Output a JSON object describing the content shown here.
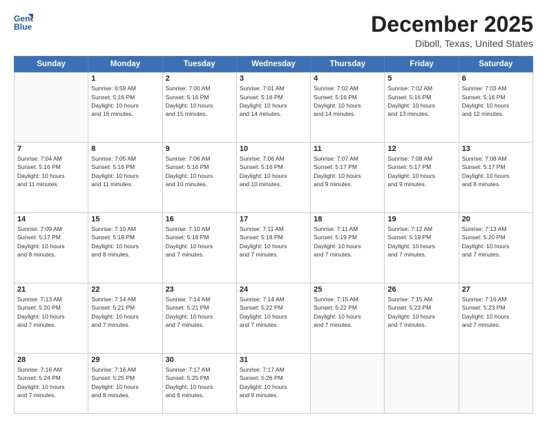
{
  "logo": {
    "line1": "General",
    "line2": "Blue"
  },
  "title": "December 2025",
  "subtitle": "Diboll, Texas, United States",
  "days_of_week": [
    "Sunday",
    "Monday",
    "Tuesday",
    "Wednesday",
    "Thursday",
    "Friday",
    "Saturday"
  ],
  "weeks": [
    [
      {
        "num": "",
        "info": ""
      },
      {
        "num": "1",
        "info": "Sunrise: 6:59 AM\nSunset: 5:16 PM\nDaylight: 10 hours\nand 16 minutes."
      },
      {
        "num": "2",
        "info": "Sunrise: 7:00 AM\nSunset: 5:16 PM\nDaylight: 10 hours\nand 15 minutes."
      },
      {
        "num": "3",
        "info": "Sunrise: 7:01 AM\nSunset: 5:16 PM\nDaylight: 10 hours\nand 14 minutes."
      },
      {
        "num": "4",
        "info": "Sunrise: 7:02 AM\nSunset: 5:16 PM\nDaylight: 10 hours\nand 14 minutes."
      },
      {
        "num": "5",
        "info": "Sunrise: 7:02 AM\nSunset: 5:16 PM\nDaylight: 10 hours\nand 13 minutes."
      },
      {
        "num": "6",
        "info": "Sunrise: 7:03 AM\nSunset: 5:16 PM\nDaylight: 10 hours\nand 12 minutes."
      }
    ],
    [
      {
        "num": "7",
        "info": "Sunrise: 7:04 AM\nSunset: 5:16 PM\nDaylight: 10 hours\nand 11 minutes."
      },
      {
        "num": "8",
        "info": "Sunrise: 7:05 AM\nSunset: 5:16 PM\nDaylight: 10 hours\nand 11 minutes."
      },
      {
        "num": "9",
        "info": "Sunrise: 7:06 AM\nSunset: 5:16 PM\nDaylight: 10 hours\nand 10 minutes."
      },
      {
        "num": "10",
        "info": "Sunrise: 7:06 AM\nSunset: 5:16 PM\nDaylight: 10 hours\nand 10 minutes."
      },
      {
        "num": "11",
        "info": "Sunrise: 7:07 AM\nSunset: 5:17 PM\nDaylight: 10 hours\nand 9 minutes."
      },
      {
        "num": "12",
        "info": "Sunrise: 7:08 AM\nSunset: 5:17 PM\nDaylight: 10 hours\nand 9 minutes."
      },
      {
        "num": "13",
        "info": "Sunrise: 7:08 AM\nSunset: 5:17 PM\nDaylight: 10 hours\nand 8 minutes."
      }
    ],
    [
      {
        "num": "14",
        "info": "Sunrise: 7:09 AM\nSunset: 5:17 PM\nDaylight: 10 hours\nand 8 minutes."
      },
      {
        "num": "15",
        "info": "Sunrise: 7:10 AM\nSunset: 5:18 PM\nDaylight: 10 hours\nand 8 minutes."
      },
      {
        "num": "16",
        "info": "Sunrise: 7:10 AM\nSunset: 5:18 PM\nDaylight: 10 hours\nand 7 minutes."
      },
      {
        "num": "17",
        "info": "Sunrise: 7:11 AM\nSunset: 5:18 PM\nDaylight: 10 hours\nand 7 minutes."
      },
      {
        "num": "18",
        "info": "Sunrise: 7:11 AM\nSunset: 5:19 PM\nDaylight: 10 hours\nand 7 minutes."
      },
      {
        "num": "19",
        "info": "Sunrise: 7:12 AM\nSunset: 5:19 PM\nDaylight: 10 hours\nand 7 minutes."
      },
      {
        "num": "20",
        "info": "Sunrise: 7:13 AM\nSunset: 5:20 PM\nDaylight: 10 hours\nand 7 minutes."
      }
    ],
    [
      {
        "num": "21",
        "info": "Sunrise: 7:13 AM\nSunset: 5:20 PM\nDaylight: 10 hours\nand 7 minutes."
      },
      {
        "num": "22",
        "info": "Sunrise: 7:14 AM\nSunset: 5:21 PM\nDaylight: 10 hours\nand 7 minutes."
      },
      {
        "num": "23",
        "info": "Sunrise: 7:14 AM\nSunset: 5:21 PM\nDaylight: 10 hours\nand 7 minutes."
      },
      {
        "num": "24",
        "info": "Sunrise: 7:14 AM\nSunset: 5:22 PM\nDaylight: 10 hours\nand 7 minutes."
      },
      {
        "num": "25",
        "info": "Sunrise: 7:15 AM\nSunset: 5:22 PM\nDaylight: 10 hours\nand 7 minutes."
      },
      {
        "num": "26",
        "info": "Sunrise: 7:15 AM\nSunset: 5:23 PM\nDaylight: 10 hours\nand 7 minutes."
      },
      {
        "num": "27",
        "info": "Sunrise: 7:16 AM\nSunset: 5:23 PM\nDaylight: 10 hours\nand 7 minutes."
      }
    ],
    [
      {
        "num": "28",
        "info": "Sunrise: 7:16 AM\nSunset: 5:24 PM\nDaylight: 10 hours\nand 7 minutes."
      },
      {
        "num": "29",
        "info": "Sunrise: 7:16 AM\nSunset: 5:25 PM\nDaylight: 10 hours\nand 8 minutes."
      },
      {
        "num": "30",
        "info": "Sunrise: 7:17 AM\nSunset: 5:25 PM\nDaylight: 10 hours\nand 8 minutes."
      },
      {
        "num": "31",
        "info": "Sunrise: 7:17 AM\nSunset: 5:26 PM\nDaylight: 10 hours\nand 9 minutes."
      },
      {
        "num": "",
        "info": ""
      },
      {
        "num": "",
        "info": ""
      },
      {
        "num": "",
        "info": ""
      }
    ]
  ]
}
